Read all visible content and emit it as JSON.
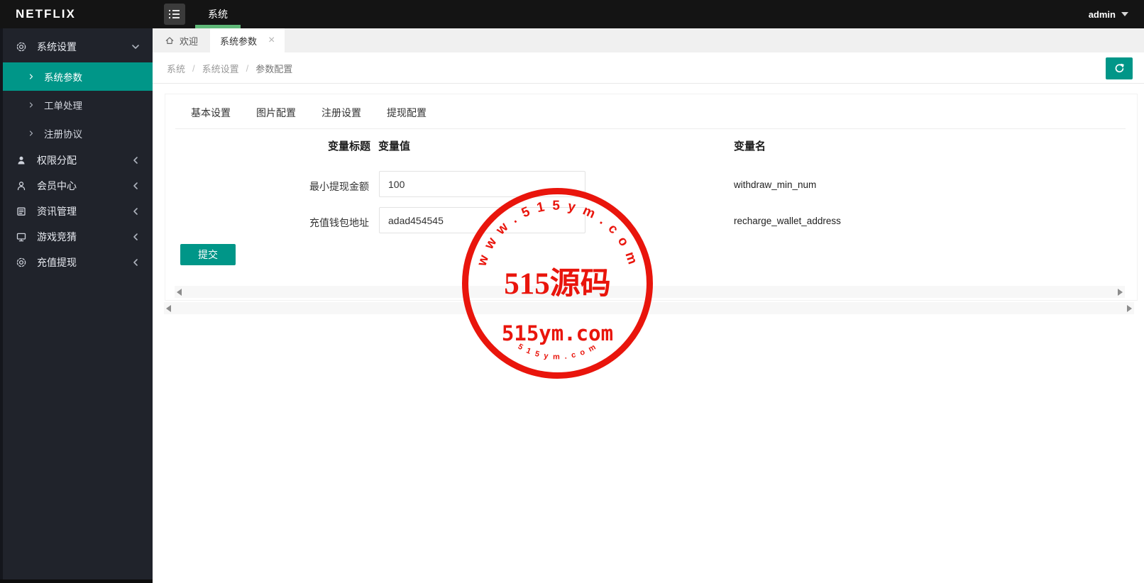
{
  "header": {
    "logo": "NETFLIX",
    "nav_item": "系统",
    "username": "admin"
  },
  "sidebar": {
    "settings_group": "系统设置",
    "settings_children": [
      "系统参数",
      "工单处理",
      "注册协议"
    ],
    "active_child": "系统参数",
    "collapsed_groups": [
      "权限分配",
      "会员中心",
      "资讯管理",
      "游戏竞猜",
      "充值提现"
    ]
  },
  "tabbar": {
    "home_tab": "欢迎",
    "active_tab": "系统参数",
    "close_icon": "×"
  },
  "breadcrumb": {
    "items": [
      "系统",
      "系统设置",
      "参数配置"
    ],
    "separator": "/"
  },
  "subtabs": [
    "基本设置",
    "图片配置",
    "注册设置",
    "提现配置"
  ],
  "form": {
    "headers": {
      "title": "变量标题",
      "value": "变量值",
      "name": "变量名"
    },
    "rows": [
      {
        "title": "最小提现金额",
        "value": "100",
        "name": "withdraw_min_num"
      },
      {
        "title": "充值钱包地址",
        "value": "adad454545",
        "name": "recharge_wallet_address"
      }
    ],
    "submit_label": "提交"
  },
  "watermark": {
    "arc_top": "w w w . 5 1 5 y m . c o m",
    "center": "515源码",
    "line2": "515ym.com",
    "arc_bottom": "5 1 5 y m . c o m",
    "color": "#e9150c"
  },
  "colors": {
    "accent_teal": "#009688",
    "accent_green": "#5fb878",
    "topbar": "#141414",
    "sidebar": "#20232b",
    "stamp_red": "#e9150c"
  }
}
